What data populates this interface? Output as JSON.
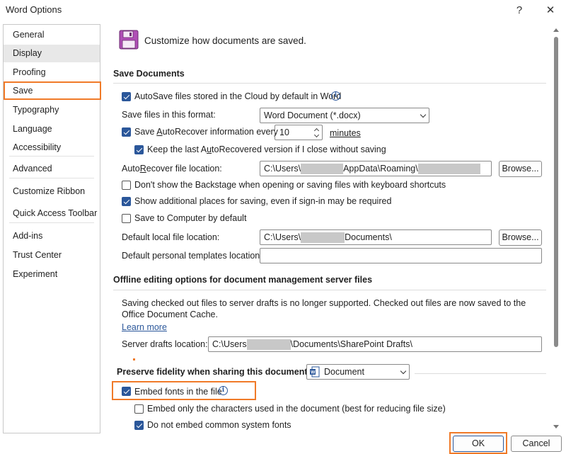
{
  "window": {
    "title": "Word Options",
    "help_glyph": "?",
    "close_glyph": "✕"
  },
  "sidebar": {
    "items": [
      {
        "label": "General"
      },
      {
        "label": "Display"
      },
      {
        "label": "Proofing"
      },
      {
        "label": "Save"
      },
      {
        "label": "Typography"
      },
      {
        "label": "Language"
      },
      {
        "label": "Accessibility"
      },
      {
        "label": "Advanced"
      },
      {
        "label": "Customize Ribbon"
      },
      {
        "label": "Quick Access Toolbar"
      },
      {
        "label": "Add-ins"
      },
      {
        "label": "Trust Center"
      },
      {
        "label": "Experiment"
      }
    ],
    "selected": "Save"
  },
  "header": {
    "text": "Customize how documents are saved."
  },
  "save_documents": {
    "heading": "Save Documents",
    "autosave_label": "AutoSave files stored in the Cloud by default in Word",
    "format_label": "Save files in this format:",
    "format_value": "Word Document (*.docx)",
    "autorecover_label_pre": "Save ",
    "autorecover_label_u": "A",
    "autorecover_label_post": "utoRecover information every",
    "autorecover_minutes": "10",
    "minutes_label": "minutes",
    "keep_last_label_pre": "Keep the last A",
    "keep_last_label_u": "u",
    "keep_last_label_post": "toRecovered version if I close without saving",
    "ar_location_label_pre": "Auto",
    "ar_location_label_u": "R",
    "ar_location_label_post": "ecover file location:",
    "ar_location_pre": "C:\\Users\\",
    "ar_location_post": "AppData\\Roaming\\",
    "browse_label": "Browse...",
    "dont_show_backstage_label": "Don't show the Backstage when opening or saving files with keyboard shortcuts",
    "show_additional_label": "Show additional places for saving, even if sign-in may be required",
    "save_to_computer_label": "Save to Computer by default",
    "default_local_label": "Default local file location:",
    "default_local_pre": "C:\\Users\\",
    "default_local_post": "Documents\\",
    "default_templates_label": "Default personal templates location:",
    "default_templates_value": ""
  },
  "offline": {
    "heading": "Offline editing options for document management server files",
    "description": "Saving checked out files to server drafts is no longer supported. Checked out files are now saved to the Office Document Cache.",
    "learn_more": "Learn more",
    "server_drafts_label": "Server drafts location:",
    "server_drafts_pre": "C:\\Users",
    "server_drafts_post": "\\Documents\\SharePoint Drafts\\"
  },
  "fidelity": {
    "heading": "Preserve fidelity when sharing this document:",
    "document_value": "Document",
    "embed_fonts_label": "Embed fonts in the file",
    "embed_only_label": "Embed only the characters used in the document (best for reducing file size)",
    "do_not_embed_label": "Do not embed common system fonts"
  },
  "checkbox_states": {
    "autosave": true,
    "autorecover": true,
    "keep_last": true,
    "dont_show_backstage": false,
    "show_additional": true,
    "save_to_computer": false,
    "embed_fonts": true,
    "embed_only": false,
    "do_not_embed": true
  },
  "footer": {
    "ok_label": "OK",
    "cancel_label": "Cancel"
  },
  "colors": {
    "accent": "#2b579a",
    "highlight": "#f07a28",
    "selected_nav": "#e8e8e8"
  }
}
